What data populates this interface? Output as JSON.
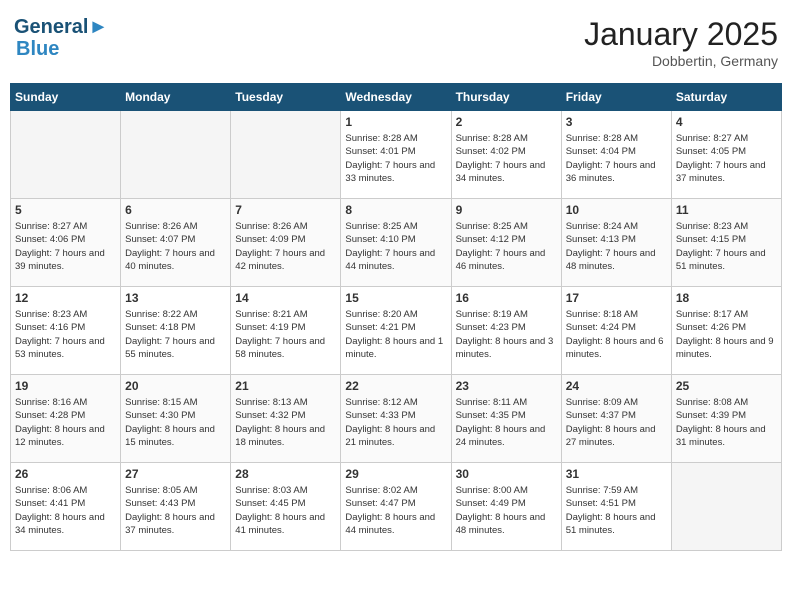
{
  "header": {
    "logo_text1": "General",
    "logo_text2": "Blue",
    "month_title": "January 2025",
    "location": "Dobbertin, Germany"
  },
  "weekdays": [
    "Sunday",
    "Monday",
    "Tuesday",
    "Wednesday",
    "Thursday",
    "Friday",
    "Saturday"
  ],
  "weeks": [
    [
      {
        "day": "",
        "empty": true
      },
      {
        "day": "",
        "empty": true
      },
      {
        "day": "",
        "empty": true
      },
      {
        "day": "1",
        "sunrise": "8:28 AM",
        "sunset": "4:01 PM",
        "daylight": "7 hours and 33 minutes."
      },
      {
        "day": "2",
        "sunrise": "8:28 AM",
        "sunset": "4:02 PM",
        "daylight": "7 hours and 34 minutes."
      },
      {
        "day": "3",
        "sunrise": "8:28 AM",
        "sunset": "4:04 PM",
        "daylight": "7 hours and 36 minutes."
      },
      {
        "day": "4",
        "sunrise": "8:27 AM",
        "sunset": "4:05 PM",
        "daylight": "7 hours and 37 minutes."
      }
    ],
    [
      {
        "day": "5",
        "sunrise": "8:27 AM",
        "sunset": "4:06 PM",
        "daylight": "7 hours and 39 minutes."
      },
      {
        "day": "6",
        "sunrise": "8:26 AM",
        "sunset": "4:07 PM",
        "daylight": "7 hours and 40 minutes."
      },
      {
        "day": "7",
        "sunrise": "8:26 AM",
        "sunset": "4:09 PM",
        "daylight": "7 hours and 42 minutes."
      },
      {
        "day": "8",
        "sunrise": "8:25 AM",
        "sunset": "4:10 PM",
        "daylight": "7 hours and 44 minutes."
      },
      {
        "day": "9",
        "sunrise": "8:25 AM",
        "sunset": "4:12 PM",
        "daylight": "7 hours and 46 minutes."
      },
      {
        "day": "10",
        "sunrise": "8:24 AM",
        "sunset": "4:13 PM",
        "daylight": "7 hours and 48 minutes."
      },
      {
        "day": "11",
        "sunrise": "8:23 AM",
        "sunset": "4:15 PM",
        "daylight": "7 hours and 51 minutes."
      }
    ],
    [
      {
        "day": "12",
        "sunrise": "8:23 AM",
        "sunset": "4:16 PM",
        "daylight": "7 hours and 53 minutes."
      },
      {
        "day": "13",
        "sunrise": "8:22 AM",
        "sunset": "4:18 PM",
        "daylight": "7 hours and 55 minutes."
      },
      {
        "day": "14",
        "sunrise": "8:21 AM",
        "sunset": "4:19 PM",
        "daylight": "7 hours and 58 minutes."
      },
      {
        "day": "15",
        "sunrise": "8:20 AM",
        "sunset": "4:21 PM",
        "daylight": "8 hours and 1 minute."
      },
      {
        "day": "16",
        "sunrise": "8:19 AM",
        "sunset": "4:23 PM",
        "daylight": "8 hours and 3 minutes."
      },
      {
        "day": "17",
        "sunrise": "8:18 AM",
        "sunset": "4:24 PM",
        "daylight": "8 hours and 6 minutes."
      },
      {
        "day": "18",
        "sunrise": "8:17 AM",
        "sunset": "4:26 PM",
        "daylight": "8 hours and 9 minutes."
      }
    ],
    [
      {
        "day": "19",
        "sunrise": "8:16 AM",
        "sunset": "4:28 PM",
        "daylight": "8 hours and 12 minutes."
      },
      {
        "day": "20",
        "sunrise": "8:15 AM",
        "sunset": "4:30 PM",
        "daylight": "8 hours and 15 minutes."
      },
      {
        "day": "21",
        "sunrise": "8:13 AM",
        "sunset": "4:32 PM",
        "daylight": "8 hours and 18 minutes."
      },
      {
        "day": "22",
        "sunrise": "8:12 AM",
        "sunset": "4:33 PM",
        "daylight": "8 hours and 21 minutes."
      },
      {
        "day": "23",
        "sunrise": "8:11 AM",
        "sunset": "4:35 PM",
        "daylight": "8 hours and 24 minutes."
      },
      {
        "day": "24",
        "sunrise": "8:09 AM",
        "sunset": "4:37 PM",
        "daylight": "8 hours and 27 minutes."
      },
      {
        "day": "25",
        "sunrise": "8:08 AM",
        "sunset": "4:39 PM",
        "daylight": "8 hours and 31 minutes."
      }
    ],
    [
      {
        "day": "26",
        "sunrise": "8:06 AM",
        "sunset": "4:41 PM",
        "daylight": "8 hours and 34 minutes."
      },
      {
        "day": "27",
        "sunrise": "8:05 AM",
        "sunset": "4:43 PM",
        "daylight": "8 hours and 37 minutes."
      },
      {
        "day": "28",
        "sunrise": "8:03 AM",
        "sunset": "4:45 PM",
        "daylight": "8 hours and 41 minutes."
      },
      {
        "day": "29",
        "sunrise": "8:02 AM",
        "sunset": "4:47 PM",
        "daylight": "8 hours and 44 minutes."
      },
      {
        "day": "30",
        "sunrise": "8:00 AM",
        "sunset": "4:49 PM",
        "daylight": "8 hours and 48 minutes."
      },
      {
        "day": "31",
        "sunrise": "7:59 AM",
        "sunset": "4:51 PM",
        "daylight": "8 hours and 51 minutes."
      },
      {
        "day": "",
        "empty": true
      }
    ]
  ]
}
